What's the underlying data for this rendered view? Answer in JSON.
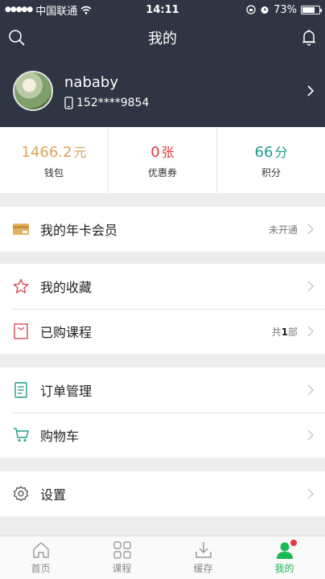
{
  "status_bar": {
    "carrier": "中国联通",
    "time": "14:11",
    "battery": "73%",
    "battery_level": 0.73
  },
  "header": {
    "title": "我的",
    "left_icon": "search-icon",
    "right_icon": "bell-icon"
  },
  "profile": {
    "username": "nababy",
    "phone": "152****9854"
  },
  "stats": [
    {
      "value": "1466.2",
      "unit": "元",
      "label": "钱包",
      "color": "#d9a35b"
    },
    {
      "value": "0",
      "unit": "张",
      "label": "优惠券",
      "color": "#e5383b"
    },
    {
      "value": "66",
      "unit": "分",
      "label": "积分",
      "color": "#1f9c8c"
    }
  ],
  "menu": {
    "card": {
      "label": "我的年卡会员",
      "status": "未开通"
    },
    "favorites": {
      "label": "我的收藏"
    },
    "purchased": {
      "label": "已购课程",
      "count_prefix": "共",
      "count": "1",
      "count_suffix": "部"
    },
    "orders": {
      "label": "订单管理"
    },
    "cart": {
      "label": "购物车"
    },
    "settings": {
      "label": "设置"
    }
  },
  "tabs": [
    {
      "label": "首页",
      "icon": "home-icon"
    },
    {
      "label": "课程",
      "icon": "grid-icon"
    },
    {
      "label": "缓存",
      "icon": "download-icon"
    },
    {
      "label": "我的",
      "icon": "user-icon",
      "active": true
    }
  ],
  "colors": {
    "header_bg": "#2f3542",
    "accent_green": "#19b955",
    "badge_red": "#e5383b"
  }
}
